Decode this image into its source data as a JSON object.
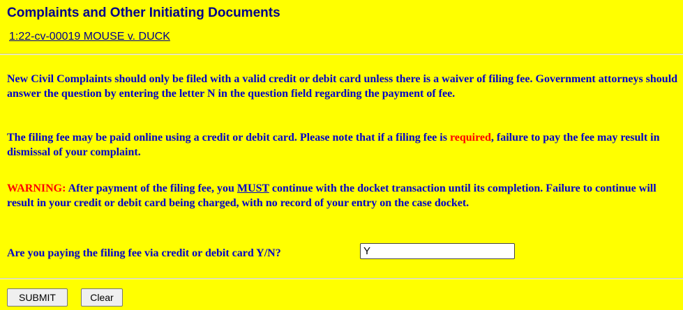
{
  "header": {
    "title": "Complaints and Other Initiating Documents",
    "case_link": "1:22-cv-00019 MOUSE v. DUCK"
  },
  "notices": {
    "p1": "New Civil Complaints should only be filed with a valid credit or debit card unless there is a waiver of filing fee. Government attorneys should answer the question by entering the letter N in the question field regarding the payment of fee.",
    "p2_a": "The filing fee may be paid online using a credit or debit card. Please note that if a filing fee is ",
    "p2_required": "required",
    "p2_b": ", failure to pay the fee may result in dismissal of your complaint.",
    "p3_warning": "WARNING:",
    "p3_a": " After payment of the filing fee, you ",
    "p3_must": "MUST",
    "p3_b": " continue with the docket transaction until its completion. Failure to continue will result in your credit or debit card being charged, with no record of your entry on the case docket."
  },
  "form": {
    "question": "Are you paying the filing fee via credit or debit card Y/N?",
    "answer_value": "Y",
    "submit_label": "SUBMIT",
    "clear_label": "Clear"
  },
  "colors": {
    "background": "#ffff00",
    "title": "#00008b",
    "text": "#0000c8",
    "alert": "#ff0000"
  }
}
